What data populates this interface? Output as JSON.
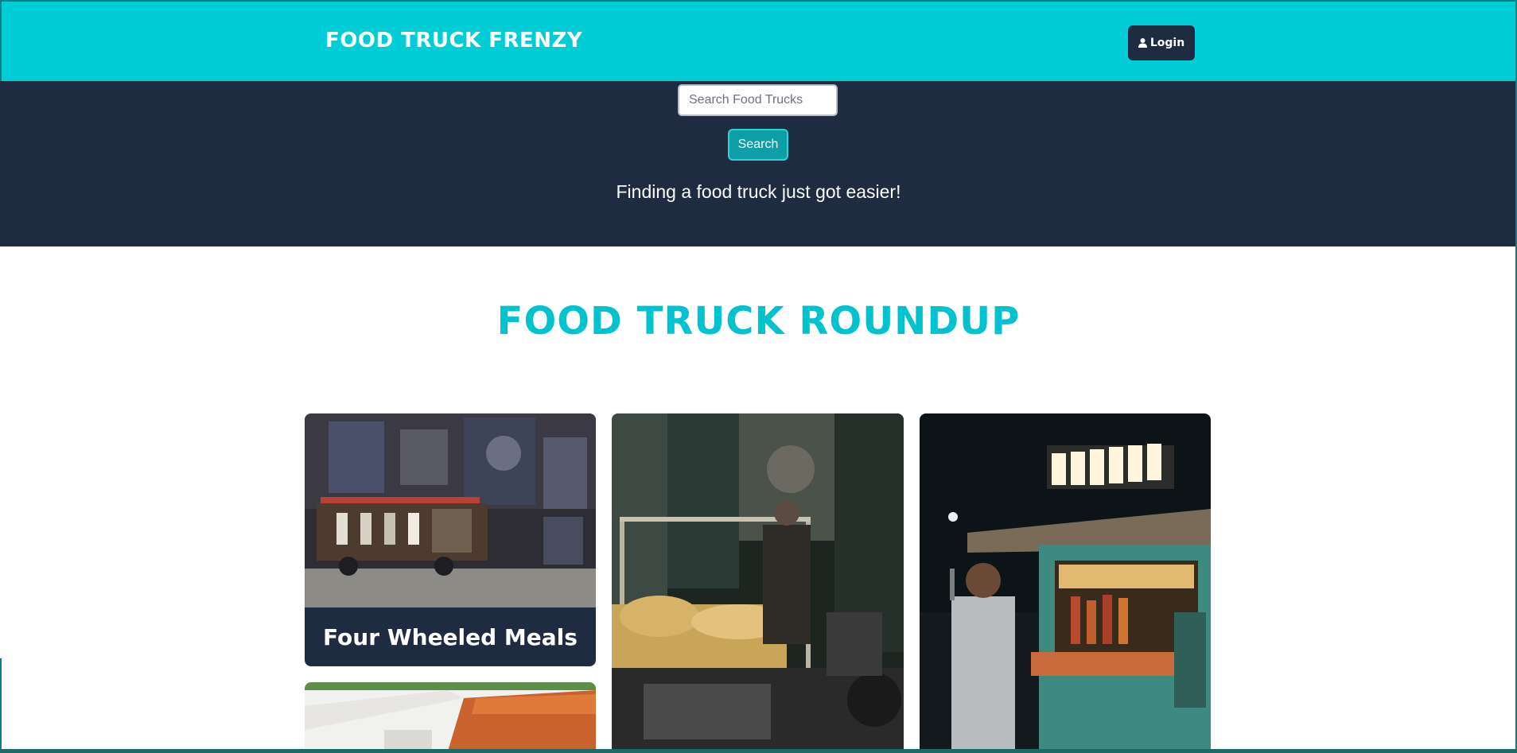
{
  "header": {
    "brand": "FOOD TRUCK FRENZY",
    "login_label": "Login"
  },
  "hero": {
    "search_placeholder": "Search Food Trucks",
    "search_button": "Search",
    "tagline": "Finding a food truck just got easier!"
  },
  "main": {
    "section_title": "FOOD TRUCK ROUNDUP",
    "cards": [
      {
        "title": "Four Wheeled Meals",
        "image": "pedal-pub-street-photo"
      },
      {
        "title": "",
        "image": "night-market-cart-photo"
      },
      {
        "title": "",
        "image": "wafels-truck-photo"
      },
      {
        "title": "",
        "image": "orange-awning-photo"
      }
    ]
  },
  "colors": {
    "brand_teal": "#00cdd6",
    "navy": "#1f2b41",
    "title_teal": "#00c3cf",
    "search_button": "#0e9fa6"
  }
}
